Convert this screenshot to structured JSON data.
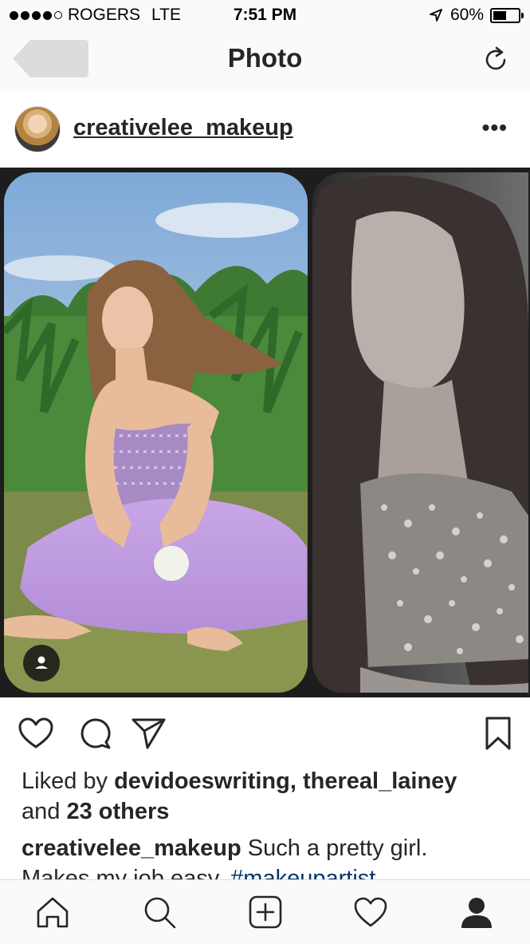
{
  "status_bar": {
    "carrier": "ROGERS",
    "network": "LTE",
    "time": "7:51 PM",
    "battery": "60%",
    "battery_level": 0.6,
    "signal_bars": 4,
    "signal_max": 5
  },
  "header": {
    "title": "Photo"
  },
  "post": {
    "username": "creativelee_makeup",
    "more_label": "•••",
    "likes": {
      "prefix": "Liked by ",
      "user1": "devidoeswriting",
      "sep": ", ",
      "user2": "thereal_lainey",
      "and": " and ",
      "others": "23 others"
    },
    "caption": {
      "username": "creativelee_makeup",
      "text": " Such a pretty girl.",
      "text2": "Makes my job easy. ",
      "hashtag": "#makeupartist"
    }
  },
  "icons": {
    "back": "back-arrow-icon",
    "refresh": "refresh-icon",
    "like": "heart-icon",
    "comment": "comment-icon",
    "share": "send-icon",
    "save": "bookmark-icon",
    "tag": "user-tag-icon",
    "tabs": [
      "home-icon",
      "search-icon",
      "add-icon",
      "activity-heart-icon",
      "profile-icon"
    ]
  },
  "colors": {
    "text": "#262626",
    "hashtag": "#003569",
    "bar_bg": "#fafafa",
    "photo_bg": "#1d1d1d"
  }
}
